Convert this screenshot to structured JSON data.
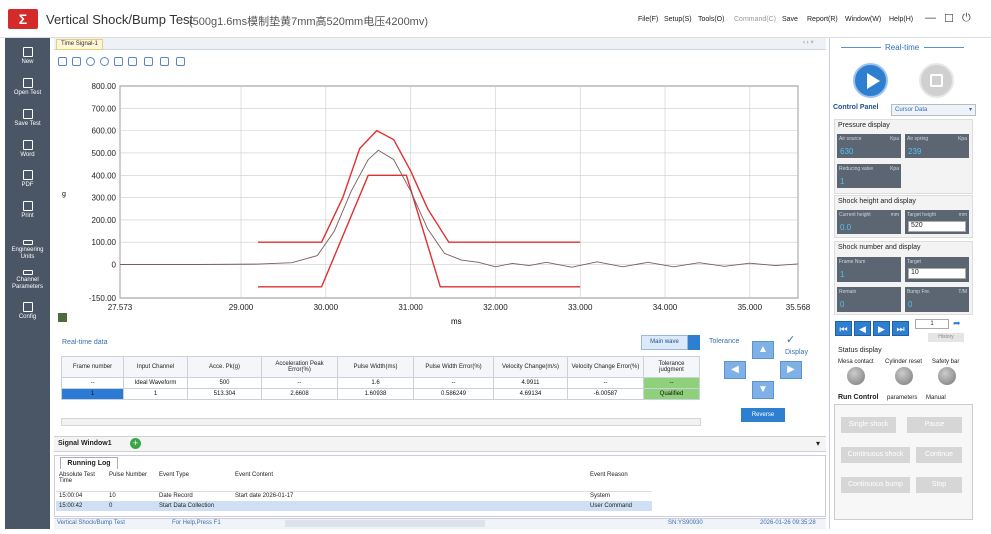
{
  "app": {
    "title": "Vertical Shock/Bump Test",
    "subtitle": "(500g1.6ms模制垫黄7mm高520mm电压4200mv)",
    "menu": [
      "File(F)",
      "Setup(S)",
      "Tools(O)",
      "Command(C)",
      "Save",
      "Report(R)",
      "Window(W)",
      "Help(H)"
    ],
    "window_controls": [
      "—",
      "☐",
      "⏻"
    ]
  },
  "sidebar": [
    {
      "label": "New",
      "icon": "new-icon"
    },
    {
      "label": "Open Test",
      "icon": "open-folder-icon"
    },
    {
      "label": "Save Test",
      "icon": "save-icon"
    },
    {
      "label": "Word",
      "icon": "word-icon"
    },
    {
      "label": "PDF",
      "icon": "pdf-icon"
    },
    {
      "label": "Print",
      "icon": "print-icon"
    },
    {
      "label": "Engineering Units",
      "icon": "ruler-icon"
    },
    {
      "label": "Channel Parameters",
      "icon": "channel-icon"
    },
    {
      "label": "Config",
      "icon": "config-icon"
    }
  ],
  "tab": {
    "label": "Time Signal-1",
    "controls": "‹ › ×"
  },
  "chart_data": {
    "type": "line",
    "xlabel": "ms",
    "ylabel": "g",
    "xlim": [
      27.573,
      35.568
    ],
    "ylim": [
      -150,
      800
    ],
    "xticks": [
      "27.573",
      "29.000",
      "30.000",
      "31.000",
      "32.000",
      "33.000",
      "34.000",
      "35.000",
      "35.568"
    ],
    "xtick_values": [
      27.573,
      29.0,
      30.0,
      31.0,
      32.0,
      33.0,
      34.0,
      35.0,
      35.568
    ],
    "yticks": [
      "800.00",
      "700.00",
      "600.00",
      "500.00",
      "400.00",
      "300.00",
      "200.00",
      "100.00",
      "0",
      "-150.00"
    ],
    "ytick_values": [
      800,
      700,
      600,
      500,
      400,
      300,
      200,
      100,
      0,
      -150
    ],
    "grid": true,
    "series": [
      {
        "role": "upper-tolerance",
        "color": "#e0302f",
        "x": [
          29.2,
          29.95,
          30.2,
          30.4,
          30.6,
          30.8,
          31.0,
          31.2,
          31.45,
          33.0
        ],
        "y": [
          100,
          100,
          300,
          520,
          600,
          560,
          420,
          250,
          100,
          100
        ]
      },
      {
        "role": "lower-tolerance",
        "color": "#e0302f",
        "x": [
          29.2,
          29.95,
          30.5,
          30.95,
          31.35,
          33.0
        ],
        "y": [
          -100,
          -100,
          400,
          400,
          -100,
          -100
        ]
      },
      {
        "role": "measured",
        "color": "#7a5c5c",
        "x": [
          27.573,
          28.5,
          29.2,
          29.6,
          29.9,
          30.1,
          30.3,
          30.5,
          30.62,
          30.8,
          31.0,
          31.2,
          31.4,
          31.6,
          31.8,
          32.0,
          32.2,
          32.4,
          32.6,
          32.9,
          33.2,
          33.5,
          33.8,
          34.1,
          34.4,
          34.7,
          35.0,
          35.3,
          35.568
        ],
        "y": [
          0,
          0,
          2,
          8,
          40,
          150,
          330,
          470,
          512,
          470,
          330,
          160,
          50,
          20,
          10,
          -10,
          5,
          -5,
          10,
          -12,
          12,
          -10,
          10,
          -10,
          8,
          -8,
          6,
          -5,
          3
        ]
      }
    ]
  },
  "realtime": {
    "label": "Real-time data",
    "main_wave": "Main wave",
    "columns": [
      "Frame number",
      "Input Channel",
      "Acce. Pk(g)",
      "Acceleration Peak Error(%)",
      "Pulse Width(ms)",
      "Pulse Width Error(%)",
      "Velocity Change(m/s)",
      "Velocity Change Error(%)",
      "Tolerance judgment"
    ],
    "rows": [
      [
        "--",
        "Ideal Waveform",
        "500",
        "--",
        "1.6",
        "--",
        "4.9911",
        "--",
        "--"
      ],
      [
        "1",
        "1",
        "513.304",
        "2.6608",
        "1.60938",
        "0.586249",
        "4.69134",
        "-6.00587",
        "Qualified"
      ]
    ]
  },
  "tolerance": {
    "label": "Tolerance",
    "check": "✓",
    "display": "Display",
    "reverse": "Reverse"
  },
  "signal_window": {
    "label": "Signal Window1",
    "add": "+",
    "dropdown": "▾"
  },
  "log": {
    "tab": "Running Log",
    "columns": [
      "Absolute Test Time",
      "Pulse Number",
      "Event Type",
      "Event Content",
      "Event Reason"
    ],
    "rows": [
      [
        "15:00:04",
        "10",
        "Date Record",
        "Start date 2026-01-17",
        "System"
      ],
      [
        "15:00:42",
        "0",
        "Start Data Collection",
        "",
        "User Command"
      ]
    ]
  },
  "status": {
    "left": "Vertical Shock/Bump Test",
    "help": "For Help,Press F1",
    "sn": "SN:YS90930",
    "time": "2026-01-26  09:35:28"
  },
  "right": {
    "title": "Real-time",
    "control_panel": "Control Panel",
    "cursor_data": "Cursor Data",
    "pressure": {
      "title": "Pressure display",
      "air_source": {
        "label": "Air source",
        "unit": "Kpa",
        "value": "630"
      },
      "air_spring": {
        "label": "Air spring",
        "unit": "Kpa",
        "value": "239"
      },
      "reducing": {
        "label": "Reducing valve",
        "unit": "Kpa",
        "value": "1"
      }
    },
    "height": {
      "title": "Shock height and display",
      "current": {
        "label": "Current height",
        "unit": "mm",
        "value": "0.0"
      },
      "target": {
        "label": "Target height",
        "unit": "mm",
        "value": "520"
      }
    },
    "number": {
      "title": "Shock number and display",
      "frame": {
        "label": "Frame Num",
        "value": "1"
      },
      "target": {
        "label": "Target",
        "value": "10"
      },
      "remain": {
        "label": "Remain",
        "value": "0"
      },
      "bump": {
        "label": "Bump Fre.",
        "unit": "T/M",
        "value": "0"
      }
    },
    "page_num": "1",
    "history": "History",
    "status": {
      "title": "Status display",
      "lamps": [
        "Mesa contact",
        "Cylinder reset",
        "Safety bar"
      ]
    },
    "run_tabs": [
      "Run Control",
      "parameters",
      "Manual"
    ],
    "buttons": [
      "Single shock",
      "Pause",
      "Continuous shock",
      "Continue",
      "Continuous bump",
      "Stop"
    ]
  }
}
